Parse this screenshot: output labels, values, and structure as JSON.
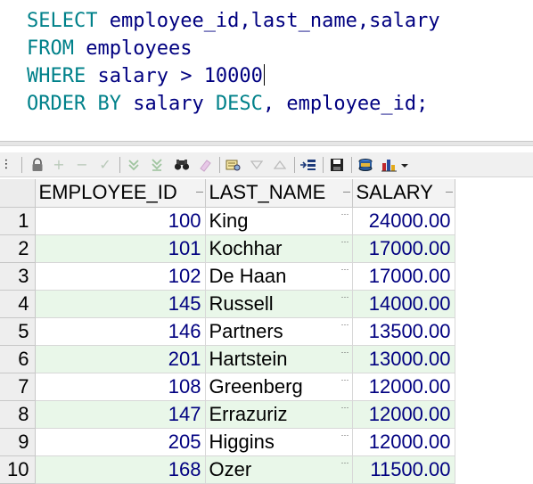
{
  "editor": {
    "line1": {
      "kw": "SELECT",
      "rest": " employee_id,last_name,salary"
    },
    "line2": {
      "kw": "FROM",
      "rest": " employees"
    },
    "line3": {
      "kw": "WHERE",
      "mid": " salary > ",
      "num": "10000"
    },
    "line4": {
      "kw": "ORDER BY",
      "rest": " salary ",
      "kw2": "DESC",
      "rest2": ", employee_id;"
    }
  },
  "toolbar": {
    "icons": [
      "grid-menu-icon",
      "lock-icon",
      "add-row-icon",
      "delete-row-icon",
      "post-changes-icon",
      "fetch-next-icon",
      "fetch-last-icon",
      "find-icon",
      "clear-filter-icon",
      "query-by-example-icon",
      "sort-down-icon",
      "sort-up-icon",
      "single-record-view-icon",
      "save-icon",
      "export-icon",
      "chart-icon"
    ]
  },
  "grid": {
    "columns": [
      "EMPLOYEE_ID",
      "LAST_NAME",
      "SALARY"
    ],
    "rows": [
      {
        "n": "1",
        "id": "100",
        "name": "King",
        "salary": "24000.00"
      },
      {
        "n": "2",
        "id": "101",
        "name": "Kochhar",
        "salary": "17000.00"
      },
      {
        "n": "3",
        "id": "102",
        "name": "De Haan",
        "salary": "17000.00"
      },
      {
        "n": "4",
        "id": "145",
        "name": "Russell",
        "salary": "14000.00"
      },
      {
        "n": "5",
        "id": "146",
        "name": "Partners",
        "salary": "13500.00"
      },
      {
        "n": "6",
        "id": "201",
        "name": "Hartstein",
        "salary": "13000.00"
      },
      {
        "n": "7",
        "id": "108",
        "name": "Greenberg",
        "salary": "12000.00"
      },
      {
        "n": "8",
        "id": "147",
        "name": "Errazuriz",
        "salary": "12000.00"
      },
      {
        "n": "9",
        "id": "205",
        "name": "Higgins",
        "salary": "12000.00"
      },
      {
        "n": "10",
        "id": "168",
        "name": "Ozer",
        "salary": "11500.00"
      }
    ]
  },
  "colors": {
    "keyword": "#00818a",
    "identifier": "#000080",
    "alt_row": "#e9f7e9"
  }
}
